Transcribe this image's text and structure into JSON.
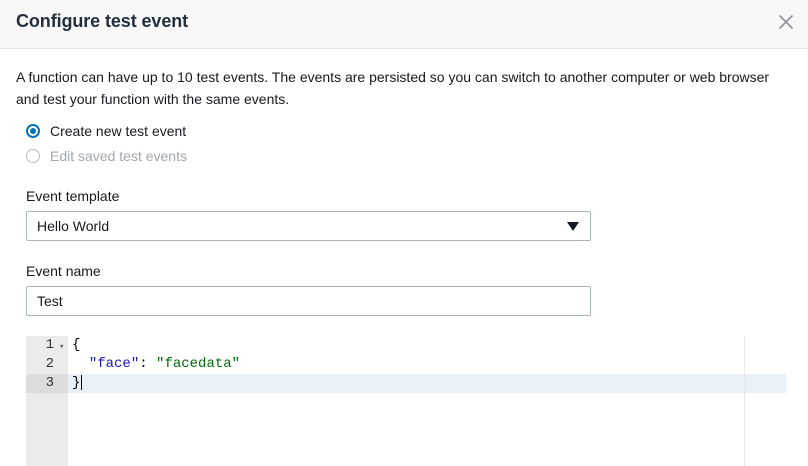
{
  "dialog": {
    "title": "Configure test event",
    "close_icon": "close-icon",
    "description": "A function can have up to 10 test events. The events are persisted so you can switch to another computer or web browser and test your function with the same events."
  },
  "mode": {
    "options": [
      {
        "label": "Create new test event",
        "selected": true,
        "disabled": false
      },
      {
        "label": "Edit saved test events",
        "selected": false,
        "disabled": true
      }
    ]
  },
  "event_template": {
    "label": "Event template",
    "value": "Hello World",
    "caret_icon": "caret-down-icon"
  },
  "event_name": {
    "label": "Event name",
    "value": "Test"
  },
  "editor": {
    "line_numbers": [
      "1",
      "2",
      "3"
    ],
    "lines": {
      "l1": "{",
      "l2_indent": "  ",
      "l2_key": "\"face\"",
      "l2_sep": ": ",
      "l2_value": "\"facedata\"",
      "l3": "}"
    },
    "colors": {
      "key": "#1a1aa6",
      "string_value": "#036a07",
      "active_line": "#e8f0f8"
    }
  },
  "colors": {
    "accent": "#0073bb",
    "header_bg": "#f8f8f8"
  }
}
